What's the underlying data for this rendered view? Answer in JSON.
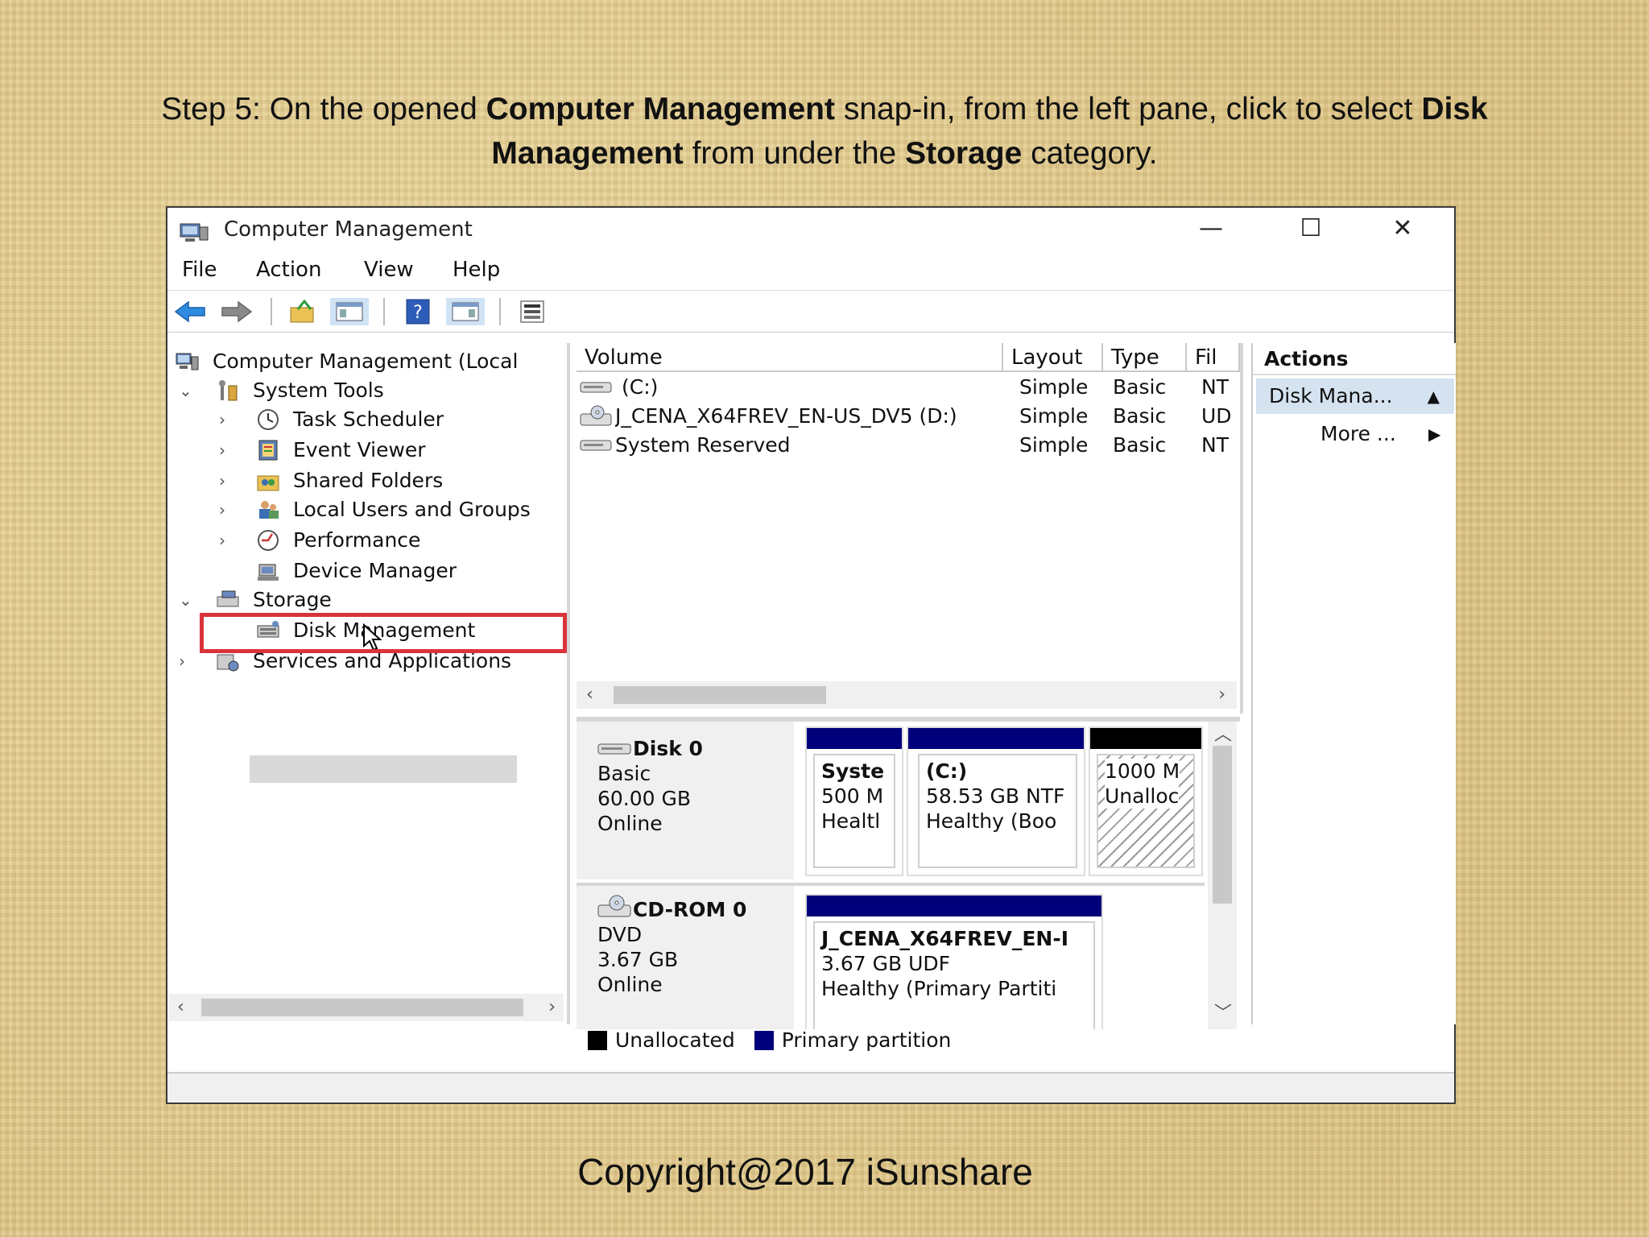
{
  "caption": {
    "t1": "Step 5: On the opened ",
    "b1": "Computer Management",
    "t2": " snap-in, from the left pane, click to select ",
    "b2": "Disk Management",
    "t3": " from under the ",
    "b3": "Storage",
    "t4": " category."
  },
  "window": {
    "title": "Computer Management",
    "controls": {
      "minimize": "—",
      "maximize": "☐",
      "close": "✕"
    }
  },
  "menu": {
    "file": "File",
    "action": "Action",
    "view": "View",
    "help": "Help"
  },
  "tree": {
    "root": "Computer Management (Local",
    "system_tools": "System Tools",
    "task_scheduler": "Task Scheduler",
    "event_viewer": "Event Viewer",
    "shared_folders": "Shared Folders",
    "local_users": "Local Users and Groups",
    "performance": "Performance",
    "device_manager": "Device Manager",
    "storage": "Storage",
    "disk_management": "Disk Management",
    "services": "Services and Applications"
  },
  "volumes": {
    "headers": {
      "volume": "Volume",
      "layout": "Layout",
      "type": "Type",
      "fs": "Fil"
    },
    "rows": [
      {
        "volume": "(C:)",
        "layout": "Simple",
        "type": "Basic",
        "fs": "NT"
      },
      {
        "volume": "J_CENA_X64FREV_EN-US_DV5 (D:)",
        "layout": "Simple",
        "type": "Basic",
        "fs": "UD"
      },
      {
        "volume": "System Reserved",
        "layout": "Simple",
        "type": "Basic",
        "fs": "NT"
      }
    ]
  },
  "disks": {
    "disk0": {
      "name": "Disk 0",
      "type": "Basic",
      "size": "60.00 GB",
      "status": "Online",
      "parts": [
        {
          "l1": "Syste",
          "l2": "500 M",
          "l3": "Healtl"
        },
        {
          "l1": "(C:)",
          "l2": "58.53 GB NTF",
          "l3": "Healthy (Boo"
        },
        {
          "l1": "",
          "l2": "1000 M",
          "l3": "Unalloc"
        }
      ]
    },
    "cdrom0": {
      "name": "CD-ROM 0",
      "type": "DVD",
      "size": "3.67 GB",
      "status": "Online",
      "part": {
        "l1": "J_CENA_X64FREV_EN-I",
        "l2": "3.67 GB UDF",
        "l3": "Healthy (Primary Partiti"
      }
    }
  },
  "legend": {
    "unallocated": "Unallocated",
    "primary": "Primary partition"
  },
  "actions": {
    "title": "Actions",
    "selected": "Disk Mana...",
    "more": "More ..."
  },
  "colors": {
    "primary_partition": "#00007a",
    "unallocated": "#000000",
    "highlight": "#d9343b"
  },
  "copyright": "Copyright@2017  iSunshare"
}
